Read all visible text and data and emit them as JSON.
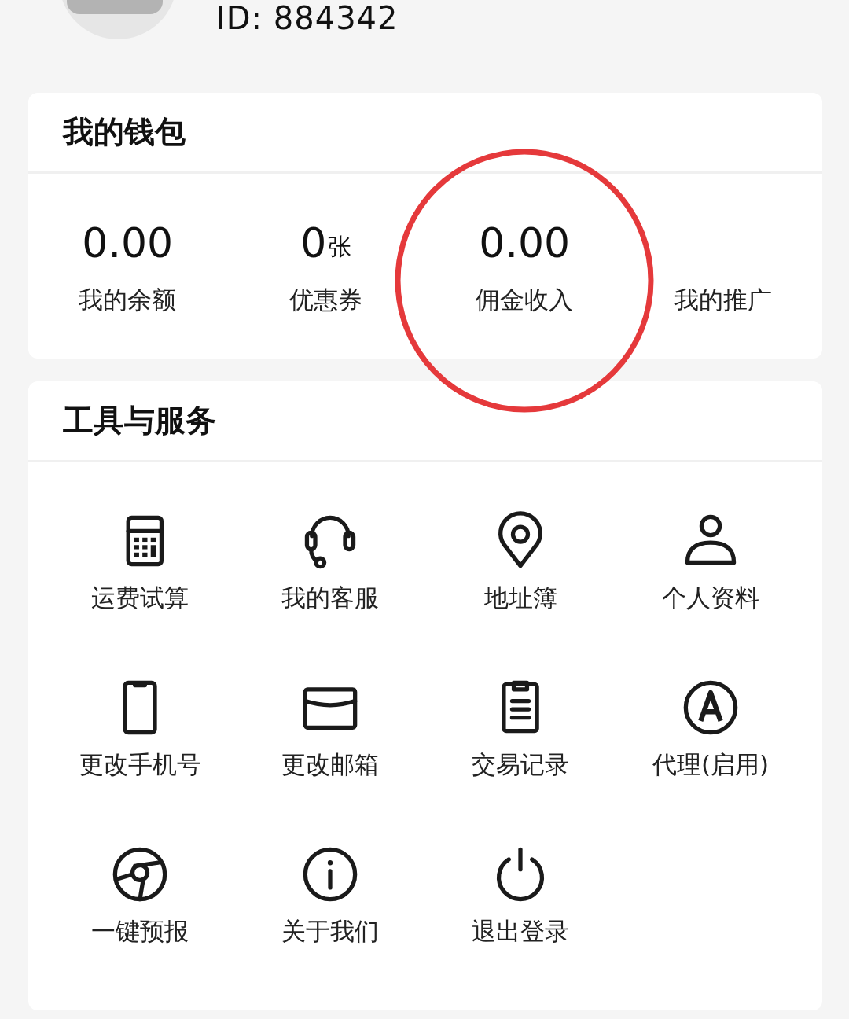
{
  "profile": {
    "user_id": "ID: 884342"
  },
  "wallet": {
    "title": "我的钱包",
    "items": [
      {
        "value": "0.00",
        "label": "我的余额",
        "circled": false
      },
      {
        "value": "0",
        "unit": "张",
        "label": "优惠券",
        "circled": false
      },
      {
        "value": "0.00",
        "label": "佣金收入",
        "circled": true
      },
      {
        "label": "我的推广",
        "circled": false
      }
    ]
  },
  "tools": {
    "title": "工具与服务",
    "items": [
      {
        "label": "运费试算"
      },
      {
        "label": "我的客服"
      },
      {
        "label": "地址簿"
      },
      {
        "label": "个人资料"
      },
      {
        "label": "更改手机号"
      },
      {
        "label": "更改邮箱"
      },
      {
        "label": "交易记录"
      },
      {
        "label": "代理(启用)"
      },
      {
        "label": "一键预报"
      },
      {
        "label": "关于我们"
      },
      {
        "label": "退出登录"
      }
    ]
  }
}
